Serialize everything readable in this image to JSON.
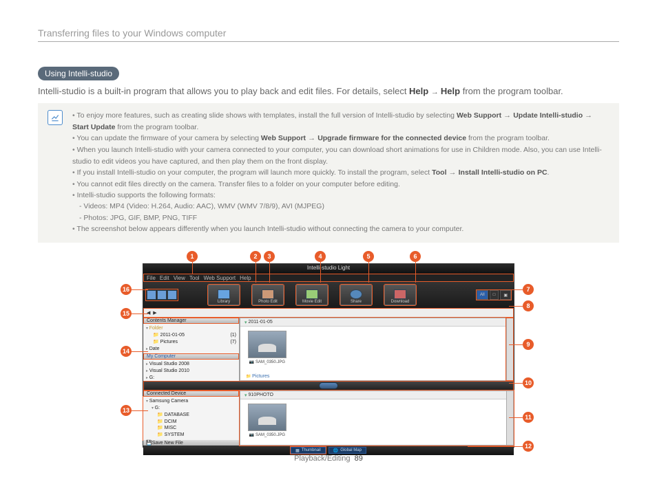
{
  "page": {
    "header": "Transferring files to your Windows computer",
    "footer_section": "Playback/Editing",
    "footer_page": "89"
  },
  "section": {
    "pill": "Using Intelli-studio",
    "intro_1": "Intelli-studio is a built-in program that allows you to play back and edit files. For details, select ",
    "intro_help1": "Help",
    "intro_arrow": " → ",
    "intro_help2": "Help",
    "intro_2": " from the program toolbar."
  },
  "notes": {
    "n1a": "To enjoy more features, such as creating slide shows with templates, install the full version of Intelli-studio by selecting ",
    "n1b": "Web Support",
    "n1c": "Update Intelli-studio",
    "n1d": "Start Update",
    "n1e": " from the program toolbar.",
    "n2a": "You can update the firmware of your camera by selecting ",
    "n2b": "Web Support",
    "n2c": "Upgrade firmware for the connected device",
    "n2d": " from the program toolbar.",
    "n3": "When you launch Intelli-studio with your camera connected to your computer, you can download short animations for use in Children mode. Also, you can use Intelli-studio to edit videos you have captured, and then play them on the front display.",
    "n4a": "If you install Intelli-studio on your computer, the program will launch more quickly. To install the program, select ",
    "n4b": "Tool",
    "n4c": "Install Intelli-studio on PC",
    "n5": "You cannot edit files directly on the camera. Transfer files to a folder on your computer before editing.",
    "n6": "Intelli-studio supports the following formats:",
    "n6v": "-  Videos: MP4 (Video: H.264, Audio: AAC), WMV (WMV 7/8/9), AVI (MJPEG)",
    "n6p": "-  Photos: JPG, GIF, BMP, PNG, TIFF",
    "n7": "The screenshot below appears differently when you launch Intelli-studio without connecting the camera to your computer."
  },
  "app": {
    "title": "Intelli-studio Light",
    "menu": [
      "File",
      "Edit",
      "View",
      "Tool",
      "Web Support",
      "Help"
    ],
    "toolbar": {
      "library": "Library",
      "photo_edit": "Photo Edit",
      "movie_edit": "Movie Edit",
      "share": "Share",
      "download": "Download"
    },
    "right_tools": {
      "all": "All",
      "photo": "□",
      "movie": "▣"
    },
    "nav_prev": "◀",
    "nav_next": "▶",
    "sidebar": {
      "contents_mgr": "Contents Manager",
      "folder": "Folder",
      "d1": "2011-01-05",
      "d1n": "(1)",
      "pics": "Pictures",
      "picsn": "(7)",
      "date": "Date",
      "my_comp": "My Computer",
      "vs08": "Visual Studio 2008",
      "vs10": "Visual Studio 2010",
      "g": "G:",
      "connected": "Connected Device",
      "cam": "Samsung Camera",
      "gdrv": "G:",
      "db": "DATABASE",
      "dcim": "DCIM",
      "misc": "MISC",
      "system": "SYSTEM",
      "save": "Save New File"
    },
    "content": {
      "group_date": "2011-01-05",
      "thumb1": "SAM_0350.JPG",
      "pictures_link": "Pictures",
      "group2": "910PHOTO",
      "thumb2": "SAM_0350.JPG"
    },
    "status": {
      "thumb": "Thumbnail",
      "map": "Global Map"
    }
  },
  "callouts": {
    "c1": "1",
    "c2": "2",
    "c3": "3",
    "c4": "4",
    "c5": "5",
    "c6": "6",
    "c7": "7",
    "c8": "8",
    "c9": "9",
    "c10": "10",
    "c11": "11",
    "c12": "12",
    "c13": "13",
    "c14": "14",
    "c15": "15",
    "c16": "16"
  }
}
